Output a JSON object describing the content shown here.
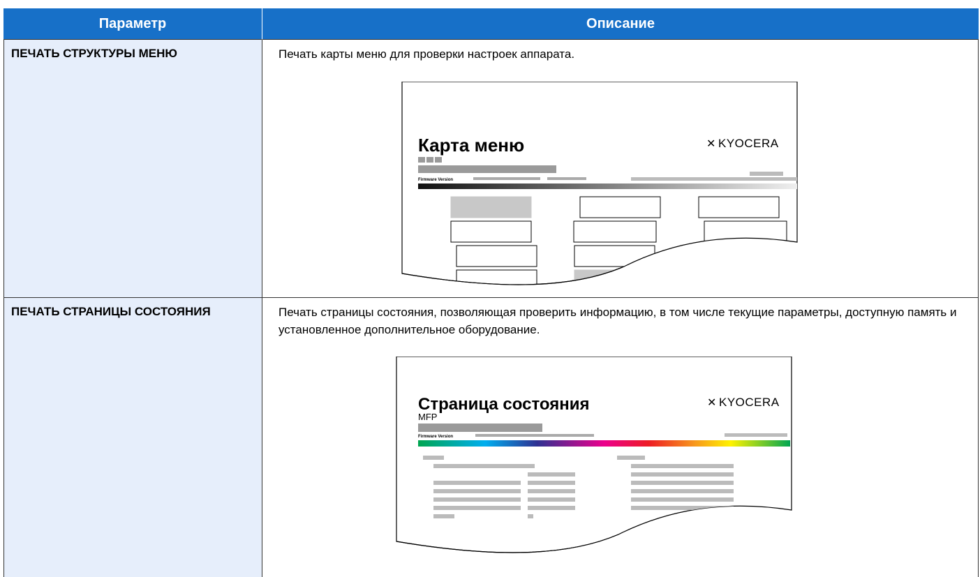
{
  "header": {
    "col_param": "Параметр",
    "col_desc": "Описание"
  },
  "rows": [
    {
      "param": "ПЕЧАТЬ СТРУКТУРЫ МЕНЮ",
      "desc": "Печать карты меню для проверки настроек аппарата.",
      "illustration": {
        "title": "Карта меню",
        "logo": "KYOCERA",
        "fw_label": "Firmware Version"
      }
    },
    {
      "param": "ПЕЧАТЬ СТРАНИЦЫ СОСТОЯНИЯ",
      "desc": "Печать страницы состояния, позволяющая проверить информацию, в том числе текущие параметры, доступную память и установленное дополнительное оборудование.",
      "illustration": {
        "title": "Страница состояния",
        "subtitle": "MFP",
        "logo": "KYOCERA",
        "fw_label": "Firmware Version"
      }
    }
  ],
  "colors": {
    "header_bg": "#1770c8",
    "param_bg": "#e6eefb"
  }
}
